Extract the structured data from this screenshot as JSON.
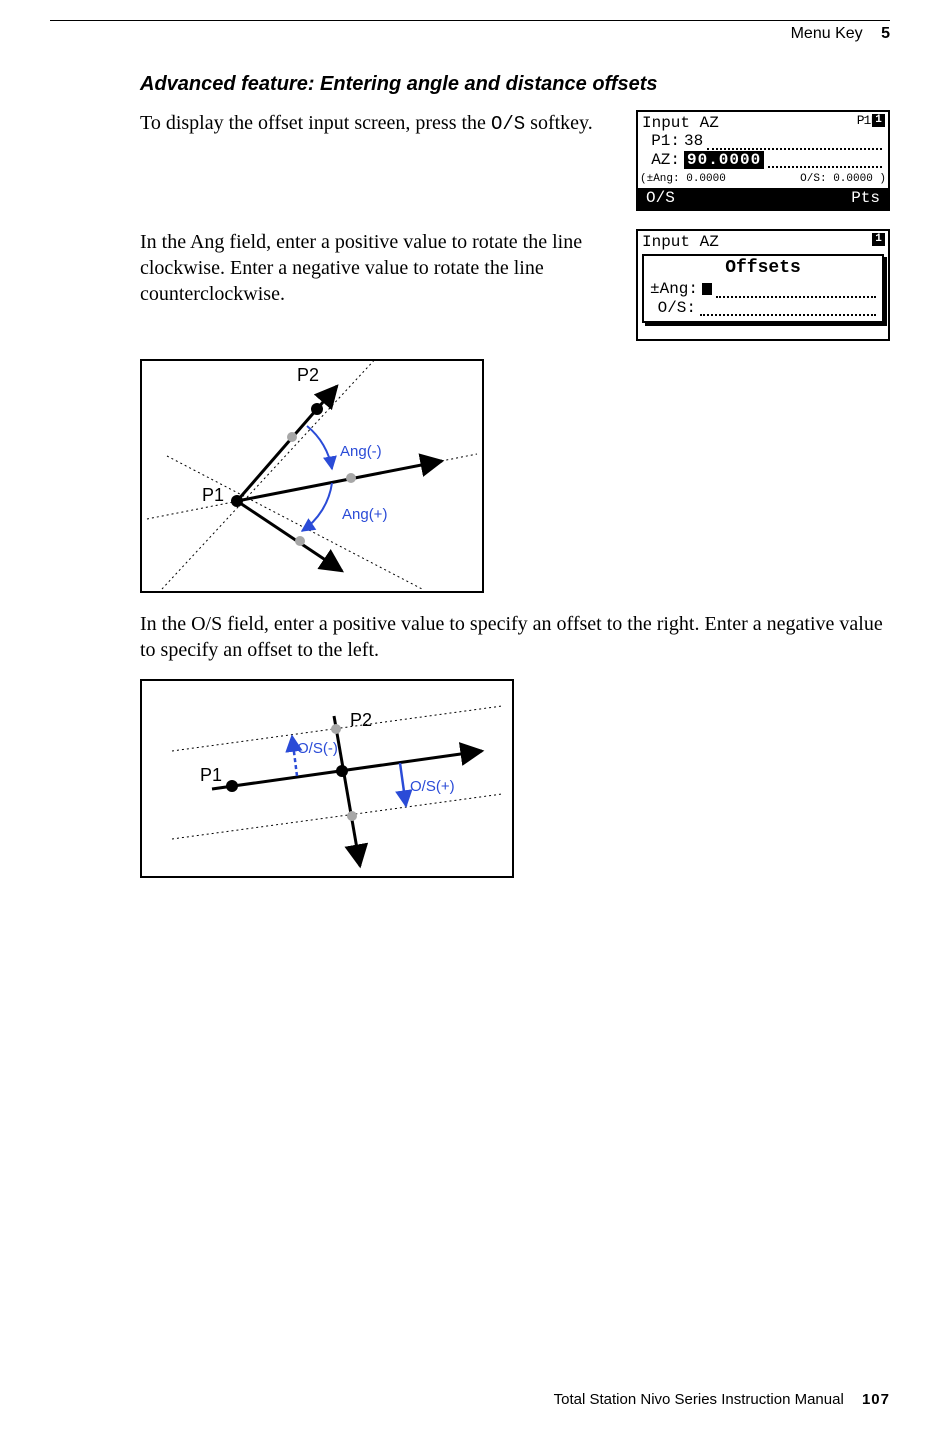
{
  "header": {
    "section": "Menu Key",
    "chapter": "5"
  },
  "heading": "Advanced feature: Entering angle and distance offsets",
  "paragraphs": {
    "p1a": "To display the offset input screen, press the ",
    "p1_key": "O/S",
    "p1b": " softkey.",
    "p2": "In the Ang field, enter a positive value to rotate the line clockwise. Enter a negative value to rotate the line counterclockwise.",
    "p3": "In the O/S field, enter a positive value to specify an offset to the right. Enter a negative value to specify an offset to the left."
  },
  "screen1": {
    "title": "Input AZ",
    "p1icon": "P1",
    "page_indicator": "1",
    "line_p1_label": "P1:",
    "line_p1_value": "38",
    "line_az_label": "AZ:",
    "line_az_value": "90.0000",
    "status_ang_label": "(±Ang:",
    "status_ang_value": "0.0000",
    "status_os_label": "O/S:",
    "status_os_value": "0.0000 )",
    "softkey_left": "O/S",
    "softkey_right": "Pts"
  },
  "screen2": {
    "title": "Input AZ",
    "page_indicator": "1",
    "box_title": "Offsets",
    "ang_label": "±Ang:",
    "os_label": "O/S:"
  },
  "diagram1": {
    "p1": "P1",
    "p2": "P2",
    "ang_neg": "Ang(-)",
    "ang_pos": "Ang(+)"
  },
  "diagram2": {
    "p1": "P1",
    "p2": "P2",
    "os_neg": "O/S(-)",
    "os_pos": "O/S(+)"
  },
  "footer": {
    "manual": "Total Station Nivo Series Instruction Manual",
    "page": "107"
  }
}
